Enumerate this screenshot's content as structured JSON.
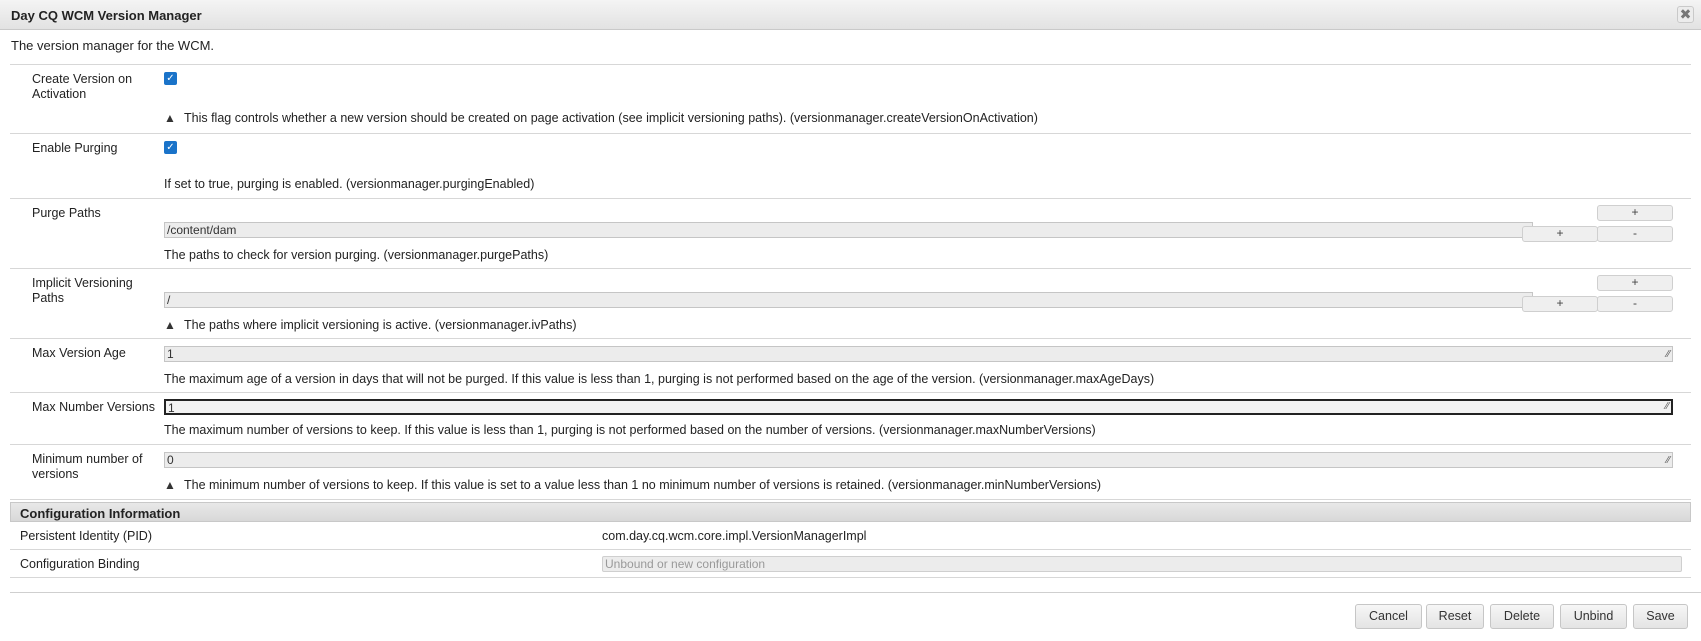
{
  "window": {
    "title": "Day CQ WCM Version Manager",
    "description": "The version manager for the WCM.",
    "close_glyph": "✖"
  },
  "fields": {
    "create_version": {
      "label": "Create Version on Activation",
      "checked": true,
      "help": "This flag controls whether a new version should be created on page activation (see implicit versioning paths). (versionmanager.createVersionOnActivation)"
    },
    "enable_purging": {
      "label": "Enable Purging",
      "checked": true,
      "help": "If set to true, purging is enabled. (versionmanager.purgingEnabled)"
    },
    "purge_paths": {
      "label": "Purge Paths",
      "value": "/content/dam",
      "help": "The paths to check for version purging. (versionmanager.purgePaths)"
    },
    "implicit_paths": {
      "label": "Implicit Versioning Paths",
      "value": "/",
      "help": "The paths where implicit versioning is active. (versionmanager.ivPaths)"
    },
    "max_age": {
      "label": "Max Version Age",
      "value": "1",
      "help": "The maximum age of a version in days that will not be purged. If this value is less than 1, purging is not performed based on the age of the version. (versionmanager.maxAgeDays)"
    },
    "max_number": {
      "label": "Max Number Versions",
      "value": "1",
      "help": "The maximum number of versions to keep. If this value is less than 1, purging is not performed based on the number of versions. (versionmanager.maxNumberVersions)"
    },
    "min_number": {
      "label": "Minimum number of versions",
      "value": "0",
      "help": "The minimum number of versions to keep. If this value is set to a value less than 1 no minimum number of versions is retained. (versionmanager.minNumberVersions)"
    }
  },
  "controls": {
    "plus": "+",
    "minus": "-",
    "check": "✓",
    "warn": "▲",
    "grip": "⁄⁄"
  },
  "config_info": {
    "header": "Configuration Information",
    "pid_label": "Persistent Identity (PID)",
    "pid_value": "com.day.cq.wcm.core.impl.VersionManagerImpl",
    "binding_label": "Configuration Binding",
    "binding_placeholder": "Unbound or new configuration"
  },
  "buttons": {
    "cancel": "Cancel",
    "reset": "Reset",
    "delete": "Delete",
    "unbind": "Unbind",
    "save": "Save"
  },
  "colors": {
    "checkbox": "#1a73c9",
    "titlebar": "#e8e8e8"
  }
}
